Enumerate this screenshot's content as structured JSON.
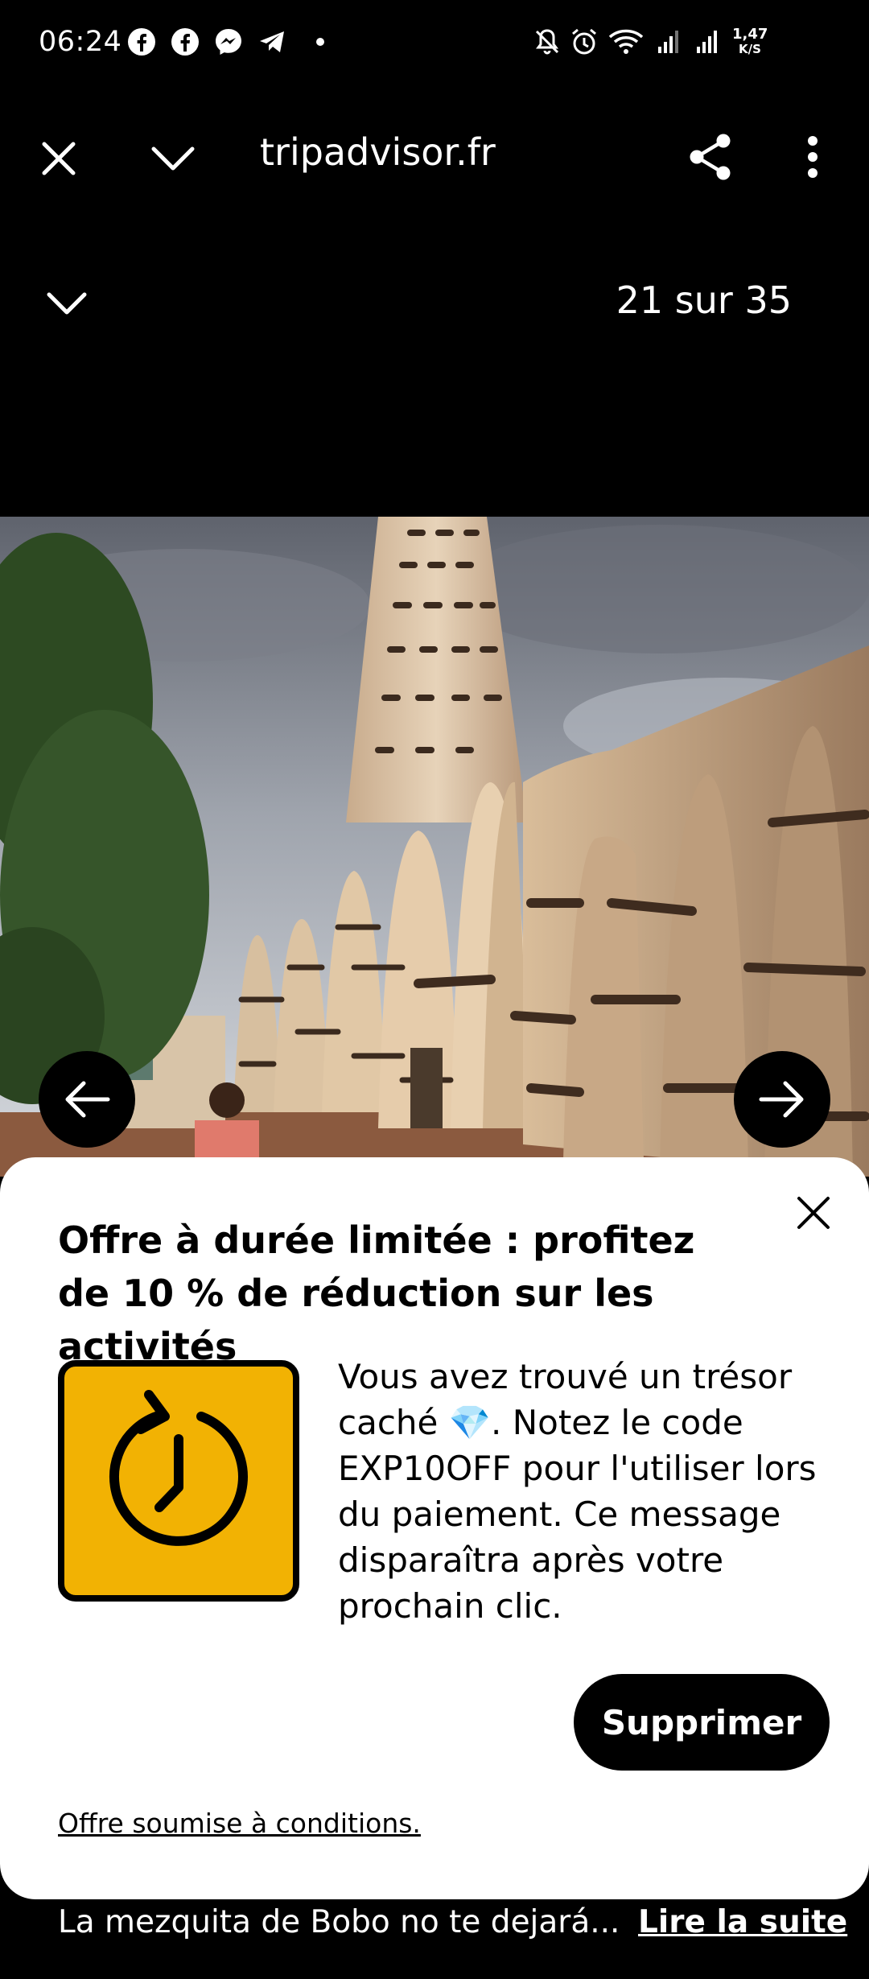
{
  "status_bar": {
    "time": "06:24",
    "network_speed_value": "1,47",
    "network_speed_unit": "K/S",
    "notification_icons": [
      "facebook-icon",
      "facebook-icon",
      "messenger-icon",
      "telegram-icon",
      "dot-icon"
    ],
    "system_icons": [
      "mute-icon",
      "alarm-icon",
      "wifi-icon",
      "signal-icon",
      "signal-icon"
    ]
  },
  "browser": {
    "url": "tripadvisor.fr",
    "close_icon": "close-icon",
    "minimize_icon": "chevron-down-icon",
    "share_icon": "share-icon",
    "menu_icon": "more-vert-icon"
  },
  "gallery": {
    "counter": "21 sur 35",
    "collapse_icon": "chevron-down-icon",
    "prev_icon": "arrow-left-icon",
    "next_icon": "arrow-right-icon"
  },
  "promo": {
    "title": "Offre à durée limitée : profitez de 10 % de réduction sur les activités",
    "body": "Vous avez trouvé un trésor caché 💎. Notez le code EXP10OFF pour l'utiliser lors du paiement. Ce message disparaîtra après votre prochain clic.",
    "button_label": "Supprimer",
    "terms_link": "Offre soumise à conditions.",
    "icon": "clock-refresh-icon",
    "accent_color": "#f2b203"
  },
  "caption": {
    "text": "La mezquita de Bobo no te dejará...",
    "more_link": "Lire la suite"
  }
}
